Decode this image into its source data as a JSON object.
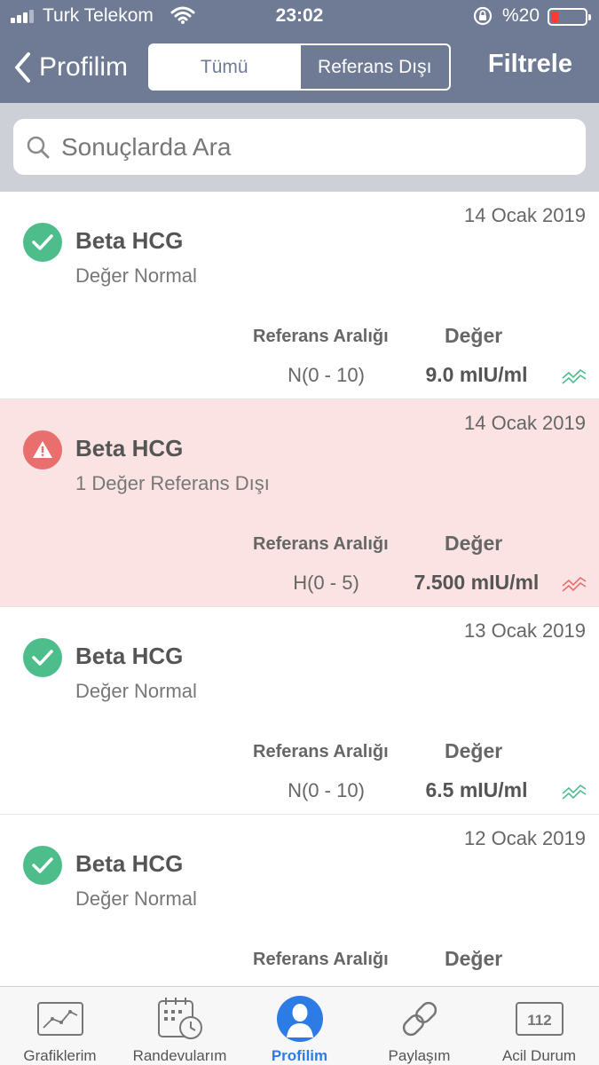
{
  "status_bar": {
    "carrier": "Turk Telekom",
    "time": "23:02",
    "battery_percent": "%20",
    "battery_level": 0.2
  },
  "nav": {
    "back_label": "Profilim",
    "segments": [
      "Tümü",
      "Referans Dışı"
    ],
    "selected_segment": "Tümü",
    "filter_label": "Filtrele"
  },
  "search": {
    "placeholder": "Sonuçlarda Ara",
    "value": ""
  },
  "results": [
    {
      "date": "14 Ocak 2019",
      "title": "Beta HCG",
      "status": "normal",
      "subtitle": "Değer Normal",
      "ref_header": "Referans Aralığı",
      "value_header": "Değer",
      "reference_range": "N(0 - 10)",
      "value": "9.0 mIU/ml"
    },
    {
      "date": "14 Ocak 2019",
      "title": "Beta HCG",
      "status": "out_of_range",
      "subtitle": "1 Değer Referans Dışı",
      "ref_header": "Referans Aralığı",
      "value_header": "Değer",
      "reference_range": "H(0 - 5)",
      "value": "7.500 mIU/ml"
    },
    {
      "date": "13 Ocak 2019",
      "title": "Beta HCG",
      "status": "normal",
      "subtitle": "Değer Normal",
      "ref_header": "Referans Aralığı",
      "value_header": "Değer",
      "reference_range": "N(0 - 10)",
      "value": "6.5 mIU/ml"
    },
    {
      "date": "12 Ocak 2019",
      "title": "Beta HCG",
      "status": "normal",
      "subtitle": "Değer Normal",
      "ref_header": "Referans Aralığı",
      "value_header": "Değer",
      "reference_range": "",
      "value": ""
    }
  ],
  "tab_bar": {
    "items": [
      {
        "label": "Grafiklerim",
        "icon": "chart-icon"
      },
      {
        "label": "Randevularım",
        "icon": "calendar-clock-icon"
      },
      {
        "label": "Profilim",
        "icon": "person-icon"
      },
      {
        "label": "Paylaşım",
        "icon": "link-icon"
      },
      {
        "label": "Acil Durum",
        "icon": "emergency-112-icon",
        "icon_text": "112"
      }
    ],
    "active": "Profilim"
  },
  "colors": {
    "header_bg": "#6f7b95",
    "normal_green": "#4dbd8c",
    "alert_red": "#e96e6e",
    "alert_row_bg": "#fbe3e3",
    "active_tab_blue": "#2d7be5"
  }
}
